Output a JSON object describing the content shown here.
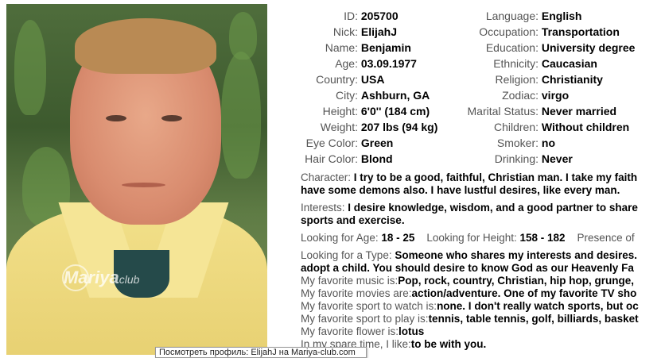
{
  "profile": {
    "left": [
      {
        "label": "ID:",
        "value": "205700"
      },
      {
        "label": "Nick:",
        "value": "ElijahJ"
      },
      {
        "label": "Name:",
        "value": "Benjamin"
      },
      {
        "label": "Age:",
        "value": "03.09.1977"
      },
      {
        "label": "Country:",
        "value": "USA"
      },
      {
        "label": "City:",
        "value": "Ashburn, GA"
      },
      {
        "label": "Height:",
        "value": "6'0'' (184 cm)"
      },
      {
        "label": "Weight:",
        "value": "207 lbs (94 kg)"
      },
      {
        "label": "Eye Color:",
        "value": "Green"
      },
      {
        "label": "Hair Color:",
        "value": "Blond"
      }
    ],
    "right": [
      {
        "label": "Language:",
        "value": "English"
      },
      {
        "label": "Occupation:",
        "value": "Transportation"
      },
      {
        "label": "Education:",
        "value": "University degree"
      },
      {
        "label": "Ethnicity:",
        "value": "Caucasian"
      },
      {
        "label": "Religion:",
        "value": "Christianity"
      },
      {
        "label": "Zodiac:",
        "value": "virgo"
      },
      {
        "label": "Marital Status:",
        "value": "Never married"
      },
      {
        "label": "Children:",
        "value": "Without children"
      },
      {
        "label": "Smoker:",
        "value": "no"
      },
      {
        "label": "Drinking:",
        "value": "Never"
      }
    ]
  },
  "bio": {
    "character_label": "Character:",
    "character_line1": "I try to be a good, faithful, Christian man. I take my faith",
    "character_line2": "have some demons also. I have lustful desires, like every man.",
    "interests_label": "Interests:",
    "interests_line1": "I desire knowledge, wisdom, and a good partner to share",
    "interests_line2": "sports and exercise.",
    "age_label": "Looking for Age:",
    "age_value": "18 - 25",
    "height_label": "Looking for Height:",
    "height_value": "158 - 182",
    "presence_label": "Presence of",
    "type_label": "Looking for a Type:",
    "type_line1": "Someone who shares my interests and desires.",
    "type_line2": "adopt a child. You should desire to know God as our Heavenly Fa",
    "music_label": "My favorite music is:",
    "music_value": "Pop, rock, country, Christian, hip hop, grunge,",
    "movies_label": "My favorite movies are:",
    "movies_value": "action/adventure. One of my favorite TV sho",
    "sport_watch_label": "My favorite sport to watch is:",
    "sport_watch_value": "none. I don't really watch sports, but oc",
    "sport_play_label": "My favorite sport to play is:",
    "sport_play_value": "tennis, table tennis, golf, billiards, basket",
    "flower_label": "My favorite flower is:",
    "flower_value": "lotus",
    "spare_label": "In my spare time, I like:",
    "spare_value": "to be with you."
  },
  "photo": {
    "watermark": "Mariya",
    "watermark_small": "club"
  },
  "tooltip": "Посмотреть профиль: ElijahJ на Mariya-club.com"
}
